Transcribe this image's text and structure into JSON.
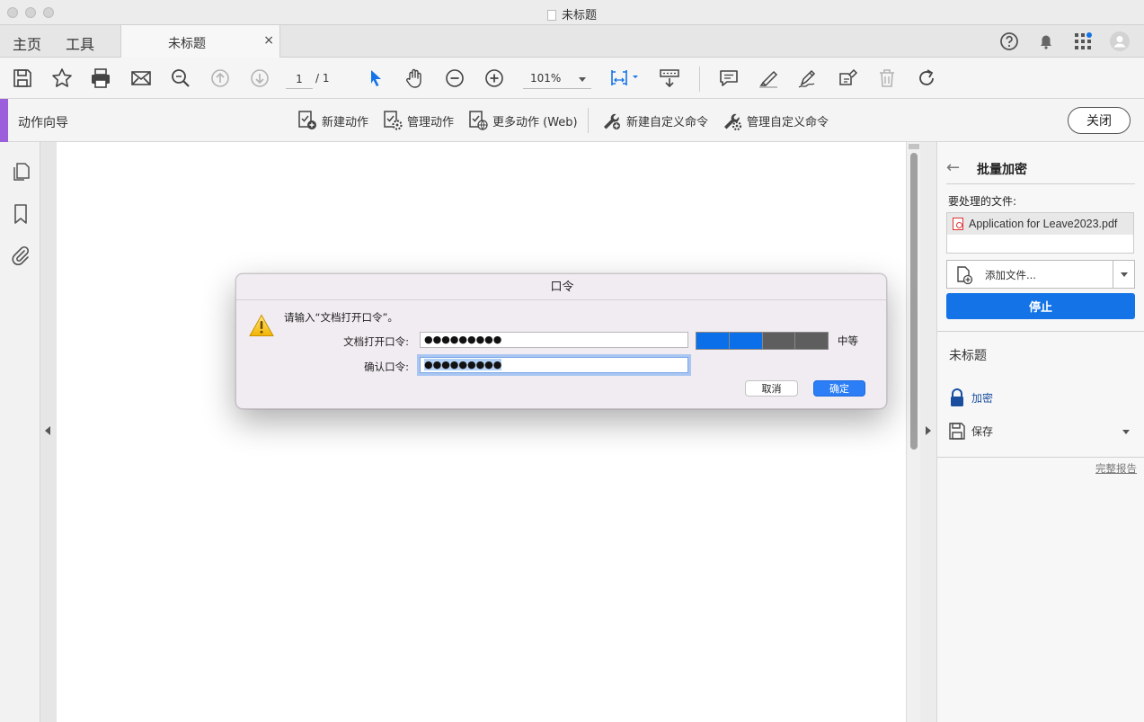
{
  "window": {
    "title": "未标题"
  },
  "tabs": {
    "home": "主页",
    "tools": "工具",
    "document_tab": "未标题",
    "close_glyph": "×"
  },
  "toolbar": {
    "page_current": "1",
    "page_total": "/ 1",
    "zoom": "101%"
  },
  "action_bar": {
    "title": "动作向导",
    "new_action": "新建动作",
    "manage_actions": "管理动作",
    "more_actions": "更多动作 (Web)",
    "new_custom_command": "新建自定义命令",
    "manage_custom_commands": "管理自定义命令",
    "close": "关闭"
  },
  "right_panel": {
    "back_glyph": "←",
    "title": "批量加密",
    "files_label": "要处理的文件:",
    "files": [
      "Application for Leave2023.pdf"
    ],
    "add_files": "添加文件...",
    "stop": "停止",
    "section_title": "未标题",
    "steps": [
      "加密",
      "保存"
    ],
    "full_report": "完整报告"
  },
  "dialog": {
    "title": "口令",
    "prompt": "请输入“文档打开口令”。",
    "open_password_label": "文档打开口令:",
    "open_password_value": "●●●●●●●●●",
    "confirm_password_label": "确认口令:",
    "confirm_password_value": "●●●●●●●●●",
    "strength": {
      "filled": 2,
      "total": 4,
      "label": "中等"
    },
    "cancel": "取消",
    "ok": "确定"
  },
  "colors": {
    "accent_blue": "#1473e6",
    "strength_fill": "#0a6fe8",
    "strength_empty": "#5e5e5e",
    "action_accent": "#9b5fdc"
  }
}
